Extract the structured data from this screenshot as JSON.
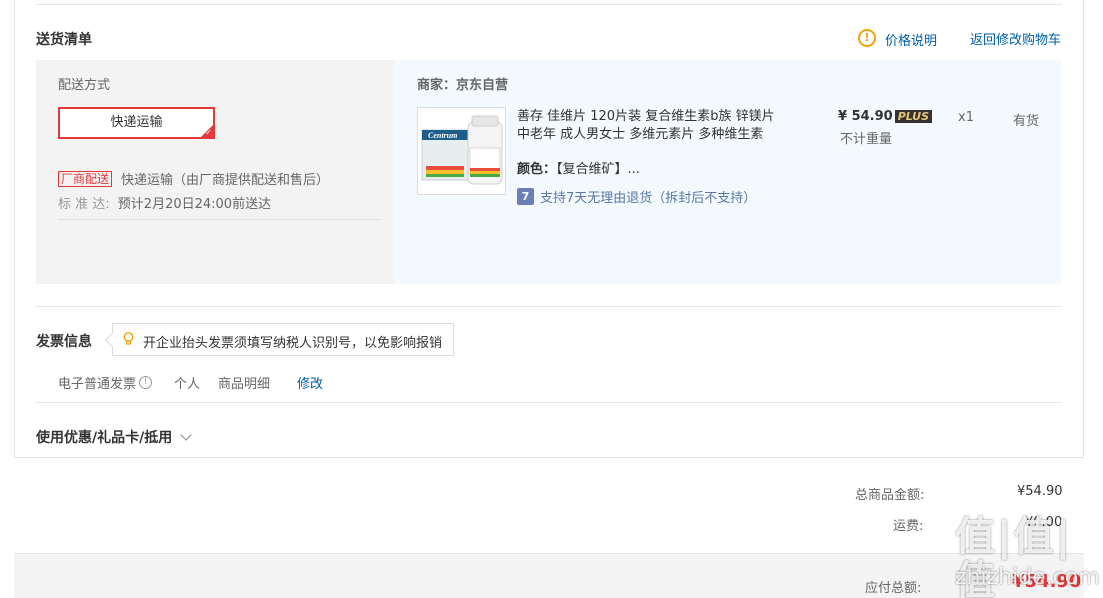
{
  "delivery": {
    "title": "送货清单",
    "price_note": "价格说明",
    "back_link": "返回修改购物车",
    "method_label": "配送方式",
    "method_selected": "快递运输",
    "factory_tag": "厂商配送",
    "factory_desc": "快递运输（由厂商提供配送和售后）",
    "standard_label": "标 准 达:",
    "standard_value": "预计2月20日24:00前送达"
  },
  "seller": {
    "label": "商家：京东自营"
  },
  "product": {
    "name_line1": "善存 佳维片 120片装 复合维生素b族 锌镁片",
    "name_line2": "中老年 成人男女士 多维元素片 多种维生素",
    "color_label": "颜色：",
    "color_value": "【复合维矿】...",
    "return_badge": "7",
    "return_text": "支持7天无理由退货（拆封后不支持）",
    "price": "¥ 54.90",
    "plus_badge": "PLUS",
    "weight_note": "不计重量",
    "qty": "x1",
    "stock": "有货",
    "image_brand": "Centrum"
  },
  "invoice": {
    "title": "发票信息",
    "tip": "开企业抬头发票须填写纳税人识别号，以免影响报销",
    "type": "电子普通发票",
    "holder": "个人",
    "content": "商品明细",
    "edit": "修改"
  },
  "coupon": {
    "title": "使用优惠/礼品卡/抵用"
  },
  "summary": {
    "goods_total_label": "总商品金额:",
    "goods_total_value": "¥54.90",
    "freight_label": "运费:",
    "freight_value": "¥0.00",
    "payable_label": "应付总额:",
    "payable_value": "¥54.90"
  },
  "watermark": {
    "logo": "值|值|值",
    "site": "zhizhide.com"
  },
  "colors": {
    "accent": "#e4393c",
    "link": "#005ea7",
    "warning": "#f0a30a"
  }
}
